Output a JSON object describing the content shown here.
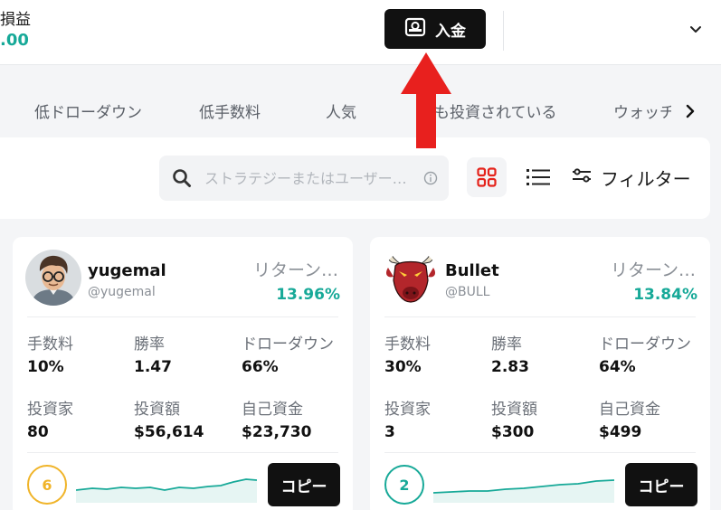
{
  "header": {
    "pl_label": "損益",
    "pl_value": ".00",
    "deposit_label": "入金"
  },
  "tabs": [
    {
      "label": "低ドローダウン"
    },
    {
      "label": "低手数料"
    },
    {
      "label": "人気"
    },
    {
      "label": "も投資されている"
    },
    {
      "label": "ウォッチ"
    }
  ],
  "search": {
    "placeholder": "ストラテジーまたはユーザー…"
  },
  "toolbar": {
    "filter_label": "フィルター"
  },
  "stat_labels": {
    "fee": "手数料",
    "win_rate": "勝率",
    "drawdown": "ドローダウン",
    "investors": "投資家",
    "invested": "投資額",
    "own_funds": "自己資金"
  },
  "cards": [
    {
      "name": "yugemal",
      "handle": "@yugemal",
      "return_label": "リターン…",
      "return_value": "13.96%",
      "fee": "10%",
      "win_rate": "1.47",
      "drawdown": "66%",
      "investors": "80",
      "invested": "$56,614",
      "own_funds": "$23,730",
      "rank": "6",
      "rank_color": "#f0b429",
      "copy_label": "コピー"
    },
    {
      "name": "Bullet",
      "handle": "@BULL",
      "return_label": "リターン…",
      "return_value": "13.84%",
      "fee": "30%",
      "win_rate": "2.83",
      "drawdown": "64%",
      "investors": "3",
      "invested": "$300",
      "own_funds": "$499",
      "rank": "2",
      "rank_color": "#17a998",
      "copy_label": "コピー"
    }
  ],
  "colors": {
    "accent_green": "#17a998",
    "grid_icon_red": "#e5231b",
    "annotation_arrow": "#e8201e"
  },
  "icons": [
    "deposit-icon",
    "chevron-down-icon",
    "search-icon",
    "info-icon",
    "grid-view-icon",
    "list-view-icon",
    "filter-icon",
    "chevron-right-icon"
  ]
}
